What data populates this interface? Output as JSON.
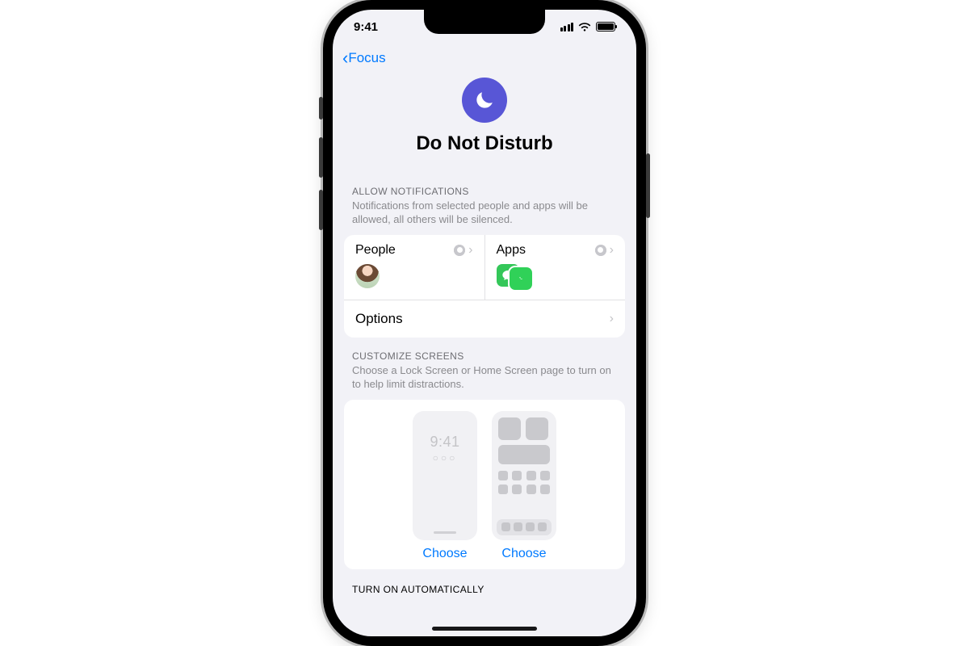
{
  "statusbar": {
    "time": "9:41"
  },
  "nav": {
    "back_label": "Focus"
  },
  "hero": {
    "title": "Do Not Disturb",
    "icon": "moon-icon"
  },
  "allow_section": {
    "title": "ALLOW NOTIFICATIONS",
    "description": "Notifications from selected people and apps will be allowed, all others will be silenced.",
    "people_label": "People",
    "apps_label": "Apps",
    "options_label": "Options",
    "apps": [
      "Messages",
      "Phone"
    ]
  },
  "customize_section": {
    "title": "CUSTOMIZE SCREENS",
    "description": "Choose a Lock Screen or Home Screen page to turn on to help limit distractions.",
    "lock_preview_time": "9:41",
    "choose_label": "Choose"
  },
  "auto_section": {
    "title": "TURN ON AUTOMATICALLY"
  },
  "colors": {
    "accent": "#007aff",
    "focus_purple": "#5856d6",
    "app_green": "#34c759"
  }
}
